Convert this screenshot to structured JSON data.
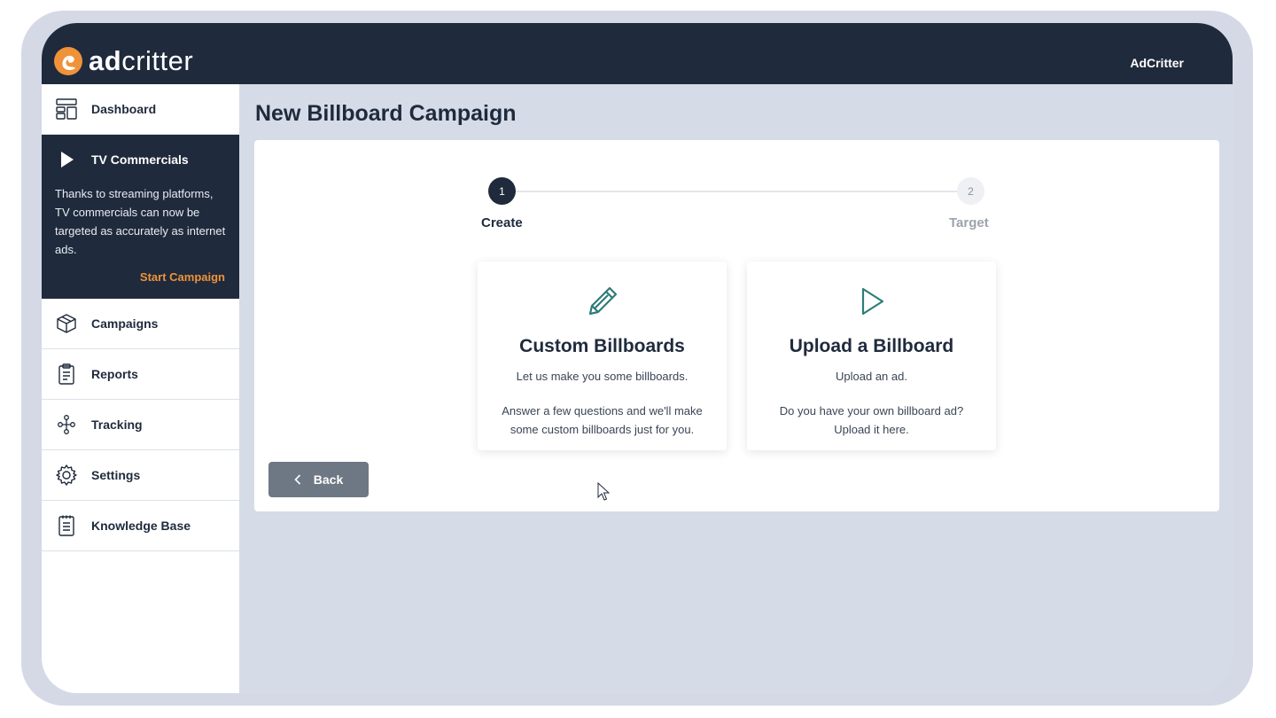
{
  "app": {
    "brand_prefix": "ad",
    "brand_suffix": "critter",
    "user_name": "AdCritter"
  },
  "sidebar": {
    "items": [
      {
        "label": "Dashboard",
        "icon": "dashboard-icon"
      },
      {
        "label": "Campaigns",
        "icon": "box-icon"
      },
      {
        "label": "Reports",
        "icon": "clipboard-icon"
      },
      {
        "label": "Tracking",
        "icon": "network-icon"
      },
      {
        "label": "Settings",
        "icon": "gear-icon"
      },
      {
        "label": "Knowledge Base",
        "icon": "notebook-icon"
      }
    ],
    "promo": {
      "title": "TV Commercials",
      "icon": "play-icon",
      "text": "Thanks to streaming platforms, TV commercials can now be targeted as accurately as internet ads.",
      "link": "Start Campaign"
    }
  },
  "main": {
    "title": "New Billboard Campaign",
    "steps": [
      {
        "number": "1",
        "label": "Create"
      },
      {
        "number": "2",
        "label": "Target"
      }
    ],
    "cards": [
      {
        "icon": "pencil-icon",
        "title": "Custom Billboards",
        "subtitle": "Let us make you some billboards.",
        "description": "Answer a few questions and we'll make some custom billboards just for you."
      },
      {
        "icon": "play-outline-icon",
        "title": "Upload a Billboard",
        "subtitle": "Upload an ad.",
        "description": "Do you have your own billboard ad? Upload it here."
      }
    ],
    "back_label": "Back"
  },
  "colors": {
    "navy": "#1f2a3c",
    "accent_orange": "#f0923a",
    "teal_icon": "#2e7d78",
    "back_button": "#6e7784"
  }
}
